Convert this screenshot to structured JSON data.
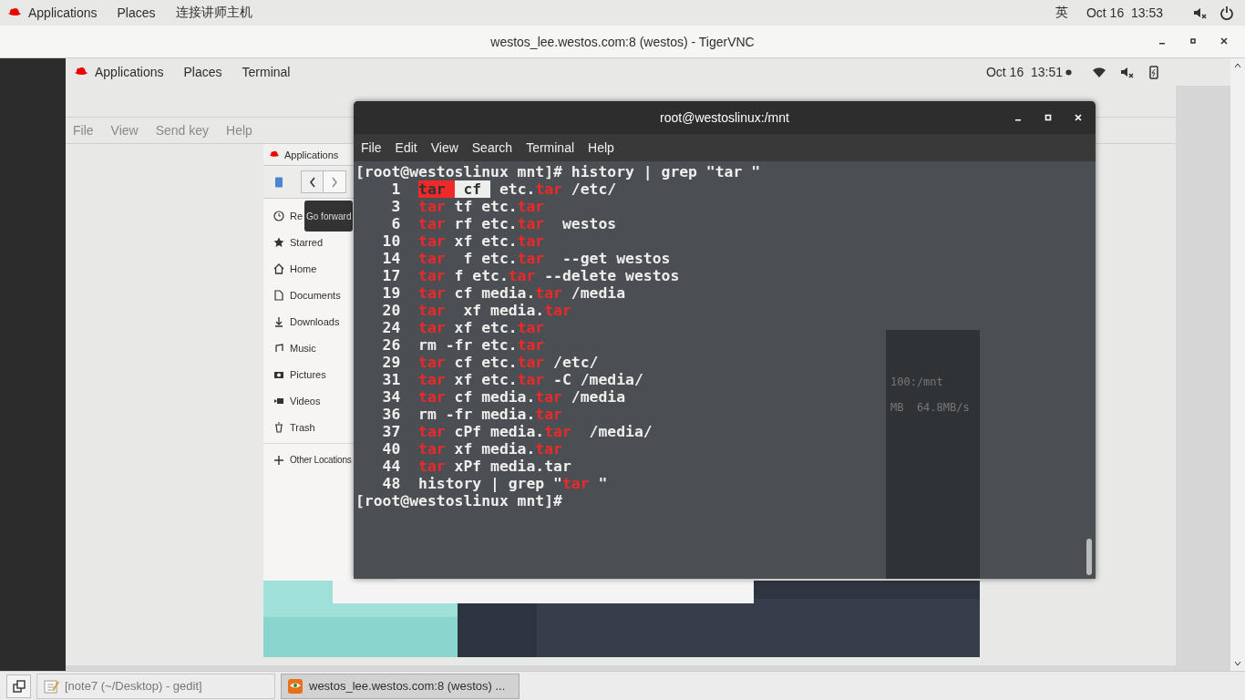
{
  "host_top_bar": {
    "menus": [
      "Applications",
      "Places",
      "连接讲师主机"
    ],
    "input_method": "英",
    "clock": "Oct 16  13:53"
  },
  "vnc_window": {
    "title": "westos_lee.westos.com:8 (westos) - TigerVNC"
  },
  "guest_top_bar": {
    "menus": [
      "Applications",
      "Places",
      "Terminal"
    ],
    "clock": "Oct 16  13:51"
  },
  "virt_viewer": {
    "menu": [
      "File",
      "View",
      "Send key",
      "Help"
    ]
  },
  "file_manager": {
    "top_bar_label": "Applications",
    "tooltip": "Go forward",
    "sidebar": [
      "Re",
      "Starred",
      "Home",
      "Documents",
      "Downloads",
      "Music",
      "Pictures",
      "Videos",
      "Trash"
    ],
    "other_locations": "Other Locations"
  },
  "terminal": {
    "title": "root@westoslinux:/mnt",
    "menu": [
      "File",
      "Edit",
      "View",
      "Search",
      "Terminal",
      "Help"
    ],
    "lines": [
      {
        "kind": "prompt",
        "text": "[root@westoslinux mnt]# history | grep \"tar \""
      },
      {
        "kind": "entry",
        "number": "1",
        "parts": [
          {
            "text": "tar ",
            "match": true,
            "selected": true
          },
          {
            "text": " cf ",
            "match": false,
            "selected": true
          },
          {
            "text": " etc.",
            "match": false,
            "selected": false
          },
          {
            "text": "tar",
            "match": true,
            "selected": false
          },
          {
            "text": " /etc/",
            "match": false,
            "selected": false
          }
        ]
      },
      {
        "kind": "entry",
        "number": "3",
        "parts": [
          {
            "text": "tar",
            "match": true,
            "selected": false
          },
          {
            "text": " tf etc.",
            "match": false,
            "selected": false
          },
          {
            "text": "tar",
            "match": true,
            "selected": false
          }
        ]
      },
      {
        "kind": "entry",
        "number": "6",
        "parts": [
          {
            "text": "tar",
            "match": true,
            "selected": false
          },
          {
            "text": " rf etc.",
            "match": false,
            "selected": false
          },
          {
            "text": "tar",
            "match": true,
            "selected": false
          },
          {
            "text": "  westos",
            "match": false,
            "selected": false
          }
        ]
      },
      {
        "kind": "entry",
        "number": "10",
        "parts": [
          {
            "text": "tar",
            "match": true,
            "selected": false
          },
          {
            "text": " xf etc.",
            "match": false,
            "selected": false
          },
          {
            "text": "tar",
            "match": true,
            "selected": false
          }
        ]
      },
      {
        "kind": "entry",
        "number": "14",
        "parts": [
          {
            "text": "tar",
            "match": true,
            "selected": false
          },
          {
            "text": "  f etc.",
            "match": false,
            "selected": false
          },
          {
            "text": "tar",
            "match": true,
            "selected": false
          },
          {
            "text": "  --get westos",
            "match": false,
            "selected": false
          }
        ]
      },
      {
        "kind": "entry",
        "number": "17",
        "parts": [
          {
            "text": "tar",
            "match": true,
            "selected": false
          },
          {
            "text": " f etc.",
            "match": false,
            "selected": false
          },
          {
            "text": "tar",
            "match": true,
            "selected": false
          },
          {
            "text": " --delete westos",
            "match": false,
            "selected": false
          }
        ]
      },
      {
        "kind": "entry",
        "number": "19",
        "parts": [
          {
            "text": "tar",
            "match": true,
            "selected": false
          },
          {
            "text": " cf media.",
            "match": false,
            "selected": false
          },
          {
            "text": "tar",
            "match": true,
            "selected": false
          },
          {
            "text": " /media",
            "match": false,
            "selected": false
          }
        ]
      },
      {
        "kind": "entry",
        "number": "20",
        "parts": [
          {
            "text": "tar",
            "match": true,
            "selected": false
          },
          {
            "text": "  xf media.",
            "match": false,
            "selected": false
          },
          {
            "text": "tar",
            "match": true,
            "selected": false
          }
        ]
      },
      {
        "kind": "entry",
        "number": "24",
        "parts": [
          {
            "text": "tar",
            "match": true,
            "selected": false
          },
          {
            "text": " xf etc.",
            "match": false,
            "selected": false
          },
          {
            "text": "tar",
            "match": true,
            "selected": false
          }
        ]
      },
      {
        "kind": "entry",
        "number": "26",
        "parts": [
          {
            "text": "rm -fr etc.",
            "match": false,
            "selected": false
          },
          {
            "text": "tar",
            "match": true,
            "selected": false
          }
        ]
      },
      {
        "kind": "entry",
        "number": "29",
        "parts": [
          {
            "text": "tar",
            "match": true,
            "selected": false
          },
          {
            "text": " cf etc.",
            "match": false,
            "selected": false
          },
          {
            "text": "tar",
            "match": true,
            "selected": false
          },
          {
            "text": " /etc/",
            "match": false,
            "selected": false
          }
        ]
      },
      {
        "kind": "entry",
        "number": "31",
        "parts": [
          {
            "text": "tar",
            "match": true,
            "selected": false
          },
          {
            "text": " xf etc.",
            "match": false,
            "selected": false
          },
          {
            "text": "tar",
            "match": true,
            "selected": false
          },
          {
            "text": " -C /media/",
            "match": false,
            "selected": false
          }
        ]
      },
      {
        "kind": "entry",
        "number": "34",
        "parts": [
          {
            "text": "tar",
            "match": true,
            "selected": false
          },
          {
            "text": " cf media.",
            "match": false,
            "selected": false
          },
          {
            "text": "tar",
            "match": true,
            "selected": false
          },
          {
            "text": " /media",
            "match": false,
            "selected": false
          }
        ]
      },
      {
        "kind": "entry",
        "number": "36",
        "parts": [
          {
            "text": "rm -fr media.",
            "match": false,
            "selected": false
          },
          {
            "text": "tar",
            "match": true,
            "selected": false
          }
        ]
      },
      {
        "kind": "entry",
        "number": "37",
        "parts": [
          {
            "text": "tar",
            "match": true,
            "selected": false
          },
          {
            "text": " cPf media.",
            "match": false,
            "selected": false
          },
          {
            "text": "tar",
            "match": true,
            "selected": false
          },
          {
            "text": "  /media/",
            "match": false,
            "selected": false
          }
        ]
      },
      {
        "kind": "entry",
        "number": "40",
        "parts": [
          {
            "text": "tar",
            "match": true,
            "selected": false
          },
          {
            "text": " xf media.",
            "match": false,
            "selected": false
          },
          {
            "text": "tar",
            "match": true,
            "selected": false
          }
        ]
      },
      {
        "kind": "entry",
        "number": "44",
        "parts": [
          {
            "text": "tar",
            "match": true,
            "selected": false
          },
          {
            "text": " xPf media.tar",
            "match": false,
            "selected": false
          }
        ]
      },
      {
        "kind": "entry",
        "number": "48",
        "parts": [
          {
            "text": "history | grep \"",
            "match": false,
            "selected": false
          },
          {
            "text": "tar",
            "match": true,
            "selected": false
          },
          {
            "text": " \"",
            "match": false,
            "selected": false
          }
        ]
      },
      {
        "kind": "prompt",
        "text": "[root@westoslinux mnt]#"
      }
    ],
    "behind_text": [
      "100:/mnt",
      "MB  64.8MB/s"
    ]
  },
  "taskbar": {
    "items": [
      {
        "kind": "editor",
        "label": "[note7 (~/Desktop) - gedit]",
        "selected": false
      },
      {
        "kind": "vnc",
        "label": "westos_lee.westos.com:8 (westos) ...",
        "selected": true
      }
    ]
  }
}
